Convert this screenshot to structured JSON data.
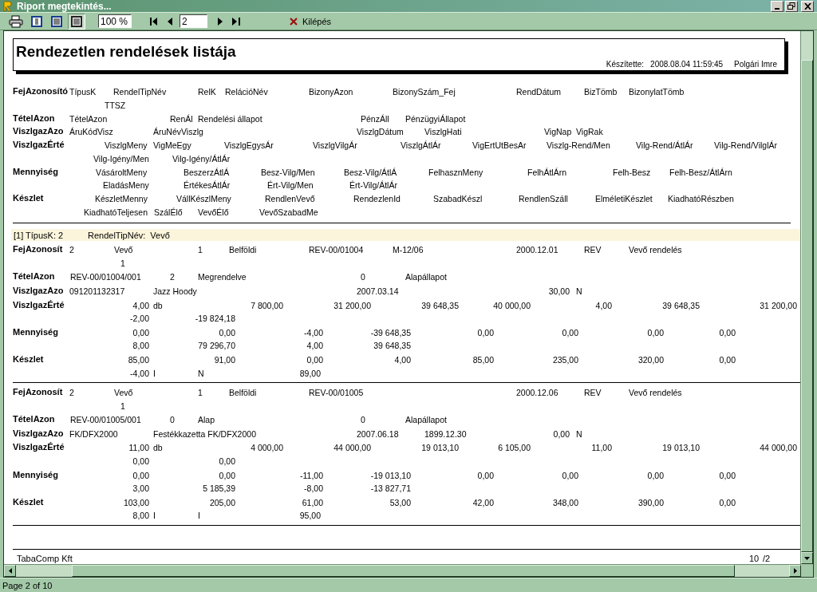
{
  "window": {
    "title": "Riport megtekintés..."
  },
  "toolbar": {
    "view_modes": [
      {
        "selected": false
      },
      {
        "selected": false
      },
      {
        "selected": true
      }
    ],
    "zoom": "100 %",
    "page": "2",
    "exit_label": "Kilépés"
  },
  "report": {
    "title": "Rendezetlen rendelések listája",
    "made_by_label": "Készítette:",
    "made_at": "2008.08.04 11:59:45",
    "author": "Polgári Imre"
  },
  "header_sections": [
    {
      "label": "FejAzonosító",
      "lines": [
        [
          "TípusK",
          "RendelTipNév",
          "RelK",
          "RelációNév",
          "BizonyAzon",
          "BizonySzám_Fej",
          "RendDátum",
          "BizTömb",
          "BizonylatTömb"
        ],
        [
          "TTSZ"
        ]
      ]
    },
    {
      "label": "TételAzon",
      "lines": [
        [
          "TételAzon",
          "RenÁl",
          "Rendelési állapot",
          "PénzÁll",
          "PénzügyiÁllapot"
        ]
      ]
    },
    {
      "label": "ViszlgazAzo",
      "lines": [
        [
          "ÁruKódVisz",
          "ÁruNévViszlg",
          "ViszlgDátum",
          "ViszlgHati",
          "VigNap",
          "VigRak"
        ]
      ]
    },
    {
      "label": "ViszlgazÉrté",
      "lines": [
        [
          "ViszlgMeny",
          "VigMeEgy",
          "ViszlgEgysÁr",
          "ViszlgVilgÁr",
          "ViszlgÁtlÁr",
          "VigErtUtBesAr",
          "Viszlg-Rend/Men",
          "Vilg-Rend/ÁtlÁr",
          "Vilg-Rend/VilglÁr"
        ],
        [
          "Vilg-Igény/Men",
          "Vilg-Igény/ÁtlÁr"
        ]
      ]
    },
    {
      "label": "Mennyiség",
      "lines": [
        [
          "VásároltMeny",
          "BeszerzÁtlÁ",
          "Besz-Vilg/Men",
          "Besz-Vilg/ÁtlÁ",
          "FelhasznMeny",
          "FelhÁtlÁrn",
          "Felh-Besz",
          "Felh-Besz/ÁtlÁrn"
        ],
        [
          "EladásMeny",
          "ÉrtékesÁtlÁr",
          "Ért-Vilg/Men",
          "Ért-Vilg/ÁtlÁr"
        ]
      ]
    },
    {
      "label": "Készlet",
      "lines": [
        [
          "KészletMenny",
          "VállKészlMeny",
          "RendlenVevő",
          "RendezlenId",
          "SzabadKészl",
          "RendlenSzáll",
          "ElméletiKészlet",
          "KiadhatóRészben"
        ],
        [
          "KiadhatóTeljesen",
          "SzálÉlő",
          "VevőÉlő",
          "VevőSzabadMe"
        ]
      ]
    }
  ],
  "group": {
    "label": "[1] TípusK: 2",
    "name_label": "RendelTipNév:",
    "name_value": "Vevő"
  },
  "records": [
    {
      "sections": [
        {
          "label": "FejAzonosít",
          "lines": [
            [
              "2",
              "Vevő",
              "1",
              "Belföldi",
              "REV-00/01004",
              "M-12/06",
              "2000.12.01",
              "REV",
              "Vevő rendelés"
            ],
            [
              "1"
            ]
          ]
        },
        {
          "label": "TételAzon",
          "lines": [
            [
              "REV-00/01004/001",
              "2",
              "Megrendelve",
              "0",
              "Alapállapot"
            ]
          ]
        },
        {
          "label": "ViszlgazAzo",
          "lines": [
            [
              "091201132317",
              "Jazz Hoody",
              "2007.03.14",
              "30,00",
              "N"
            ]
          ]
        },
        {
          "label": "ViszlgazÉrté",
          "lines": [
            [
              "4,00",
              "db",
              "7 800,00",
              "31 200,00",
              "39 648,35",
              "40 000,00",
              "4,00",
              "39 648,35",
              "31 200,00"
            ],
            [
              "-2,00",
              "-19 824,18"
            ]
          ]
        },
        {
          "label": "Mennyiség",
          "lines": [
            [
              "0,00",
              "0,00",
              "-4,00",
              "-39 648,35",
              "0,00",
              "0,00",
              "0,00",
              "0,00"
            ],
            [
              "8,00",
              "79 296,70",
              "4,00",
              "39 648,35"
            ]
          ]
        },
        {
          "label": "Készlet",
          "lines": [
            [
              "85,00",
              "91,00",
              "0,00",
              "4,00",
              "85,00",
              "235,00",
              "320,00",
              "0,00"
            ],
            [
              "-4,00",
              "I",
              "N",
              "89,00"
            ]
          ]
        }
      ]
    },
    {
      "sections": [
        {
          "label": "FejAzonosít",
          "lines": [
            [
              "2",
              "Vevő",
              "1",
              "Belföldi",
              "REV-00/01005",
              "2000.12.06",
              "REV",
              "Vevő rendelés"
            ],
            [
              "1"
            ]
          ]
        },
        {
          "label": "TételAzon",
          "lines": [
            [
              "REV-00/01005/001",
              "0",
              "Alap",
              "0",
              "Alapállapot"
            ]
          ]
        },
        {
          "label": "ViszlgazAzo",
          "lines": [
            [
              "FK/DFX2000",
              "Festékkazetta FK/DFX2000",
              "2007.06.18",
              "1899.12.30",
              "0,00",
              "N"
            ]
          ]
        },
        {
          "label": "ViszlgazÉrté",
          "lines": [
            [
              "11,00",
              "db",
              "4 000,00",
              "44 000,00",
              "19 013,10",
              "6 105,00",
              "11,00",
              "19 013,10",
              "44 000,00"
            ],
            [
              "0,00",
              "0,00"
            ]
          ]
        },
        {
          "label": "Mennyiség",
          "lines": [
            [
              "0,00",
              "0,00",
              "-11,00",
              "-19 013,10",
              "0,00",
              "0,00",
              "0,00",
              "0,00"
            ],
            [
              "3,00",
              "5 185,39",
              "-8,00",
              "-13 827,71"
            ]
          ]
        },
        {
          "label": "Készlet",
          "lines": [
            [
              "103,00",
              "205,00",
              "61,00",
              "53,00",
              "42,00",
              "348,00",
              "390,00",
              "0,00"
            ],
            [
              "8,00",
              "I",
              "I",
              "95,00"
            ]
          ]
        }
      ]
    }
  ],
  "footer": {
    "company": "TabaComp Kft",
    "page": "10",
    "total": "/2"
  },
  "status_bar": "Page 2 of 10"
}
